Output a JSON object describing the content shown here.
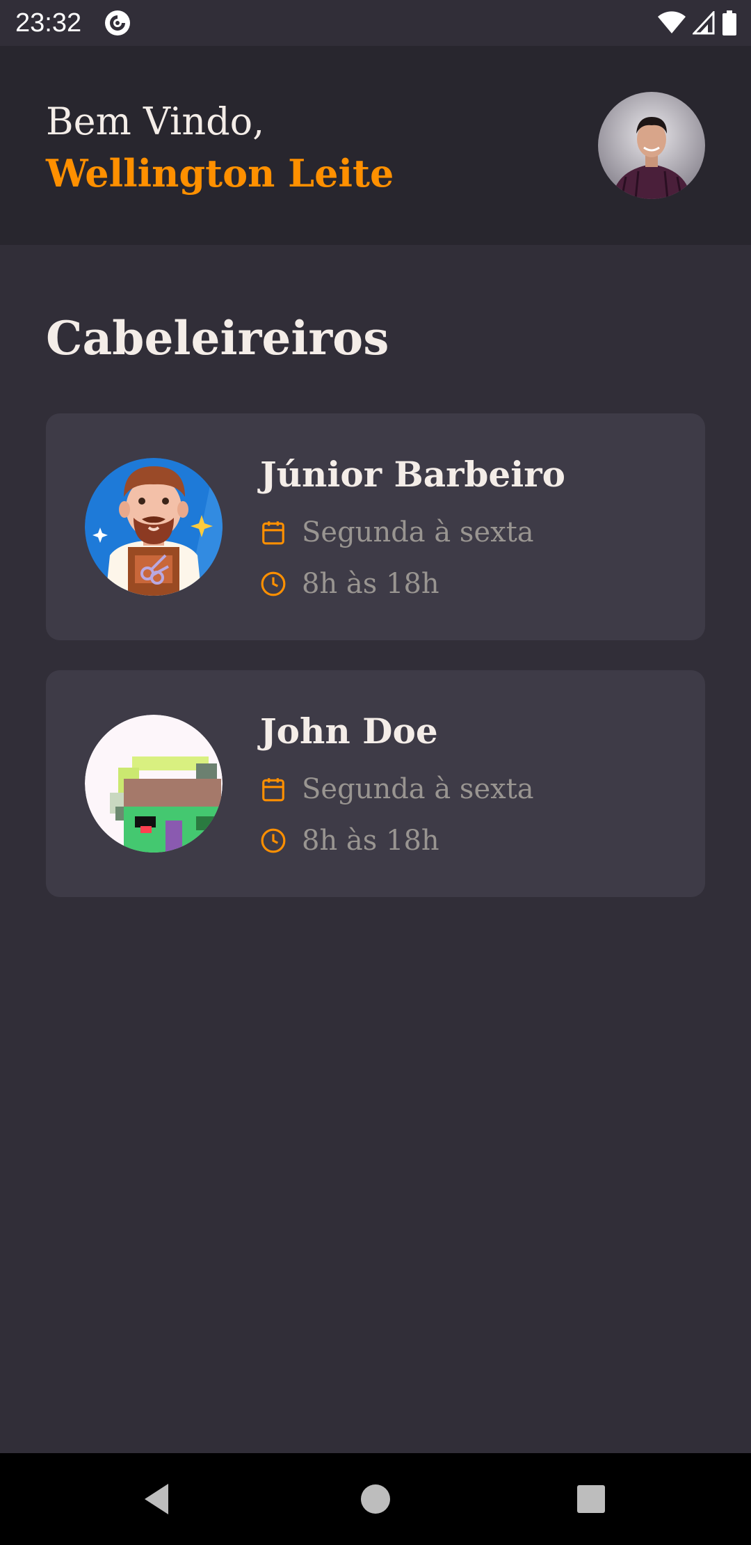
{
  "status_bar": {
    "time": "23:32",
    "app_icon": "pocket-casts-icon",
    "icons": [
      "wifi-icon",
      "signal-icon",
      "battery-icon"
    ]
  },
  "header": {
    "greeting": "Bem Vindo,",
    "user_name": "Wellington Leite",
    "avatar_icon": "user-avatar"
  },
  "section": {
    "title": "Cabeleireiros"
  },
  "providers": [
    {
      "name": "Júnior Barbeiro",
      "days": "Segunda à sexta",
      "hours": "8h às 18h",
      "avatar_icon": "barber-avatar"
    },
    {
      "name": "John Doe",
      "days": "Segunda à sexta",
      "hours": "8h às 18h",
      "avatar_icon": "pixel-avatar"
    }
  ],
  "colors": {
    "background": "#312e38",
    "header": "#28262e",
    "card": "#3e3b47",
    "accent": "#ff9000",
    "text": "#f4ede8",
    "muted": "#999591"
  }
}
